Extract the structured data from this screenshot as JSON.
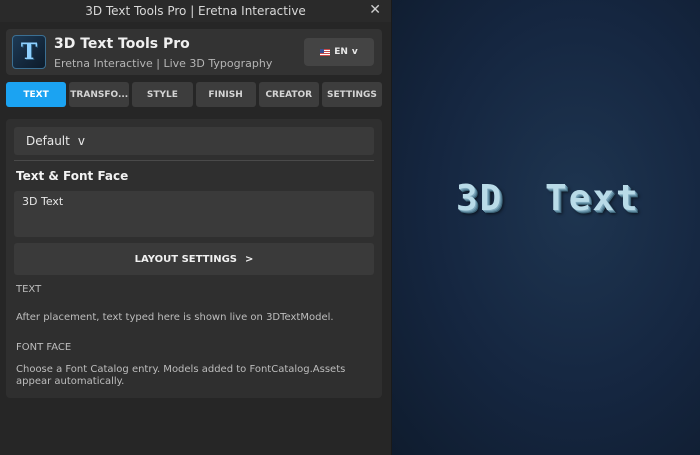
{
  "window": {
    "title": "3D Text Tools Pro | Eretna Interactive",
    "close_glyph": "✕"
  },
  "header": {
    "logo_glyph": "T",
    "app_name": "3D Text Tools Pro",
    "subtitle": "Eretna Interactive | Live 3D Typography",
    "language": {
      "label": "EN",
      "chevron": "v"
    }
  },
  "tabs": [
    {
      "label": "TEXT",
      "active": true
    },
    {
      "label": "TRANSFO...",
      "active": false
    },
    {
      "label": "STYLE",
      "active": false
    },
    {
      "label": "FINISH",
      "active": false
    },
    {
      "label": "CREATOR",
      "active": false
    },
    {
      "label": "SETTINGS",
      "active": false
    }
  ],
  "panel": {
    "preset": {
      "value": "Default",
      "chevron": "v"
    },
    "section_title": "Text & Font Face",
    "text_value": "3D Text",
    "layout_button": {
      "label": "LAYOUT SETTINGS",
      "chevron": ">"
    },
    "text_label": "TEXT",
    "text_help": "After placement, text typed here is shown live on 3DTextModel.",
    "font_label": "FONT FACE",
    "font_help": "Choose a Font Catalog entry. Models added to FontCatalog.Assets appear automatically."
  },
  "viewport": {
    "preview_text": "3D Text"
  },
  "colors": {
    "accent": "#1ba3f2",
    "window_bg": "#262626",
    "viewport_bg": "#16243a"
  }
}
